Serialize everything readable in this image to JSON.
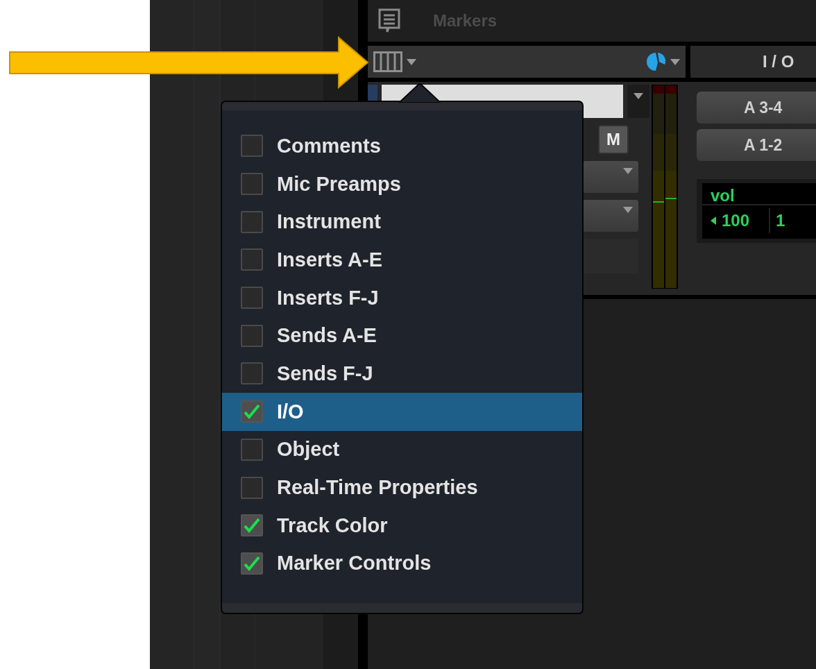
{
  "header": {
    "title": "Markers"
  },
  "view_bar": {
    "column_label": "I / O"
  },
  "track": {
    "mute_label": "M"
  },
  "outputs": [
    "A 3-4",
    "A 1-2"
  ],
  "volume": {
    "label": "vol",
    "value": "100",
    "value_2": "1"
  },
  "meters": [
    {
      "level": 0.42
    },
    {
      "level": 0.44
    }
  ],
  "menu": {
    "items": [
      {
        "label": "Comments",
        "checked": false,
        "selected": false
      },
      {
        "label": "Mic Preamps",
        "checked": false,
        "selected": false
      },
      {
        "label": "Instrument",
        "checked": false,
        "selected": false
      },
      {
        "label": "Inserts A-E",
        "checked": false,
        "selected": false
      },
      {
        "label": "Inserts F-J",
        "checked": false,
        "selected": false
      },
      {
        "label": "Sends A-E",
        "checked": false,
        "selected": false
      },
      {
        "label": "Sends F-J",
        "checked": false,
        "selected": false
      },
      {
        "label": "I/O",
        "checked": true,
        "selected": true
      },
      {
        "label": "Object",
        "checked": false,
        "selected": false
      },
      {
        "label": "Real-Time Properties",
        "checked": false,
        "selected": false
      },
      {
        "label": "Track Color",
        "checked": true,
        "selected": false
      },
      {
        "label": "Marker Controls",
        "checked": true,
        "selected": false
      }
    ]
  }
}
